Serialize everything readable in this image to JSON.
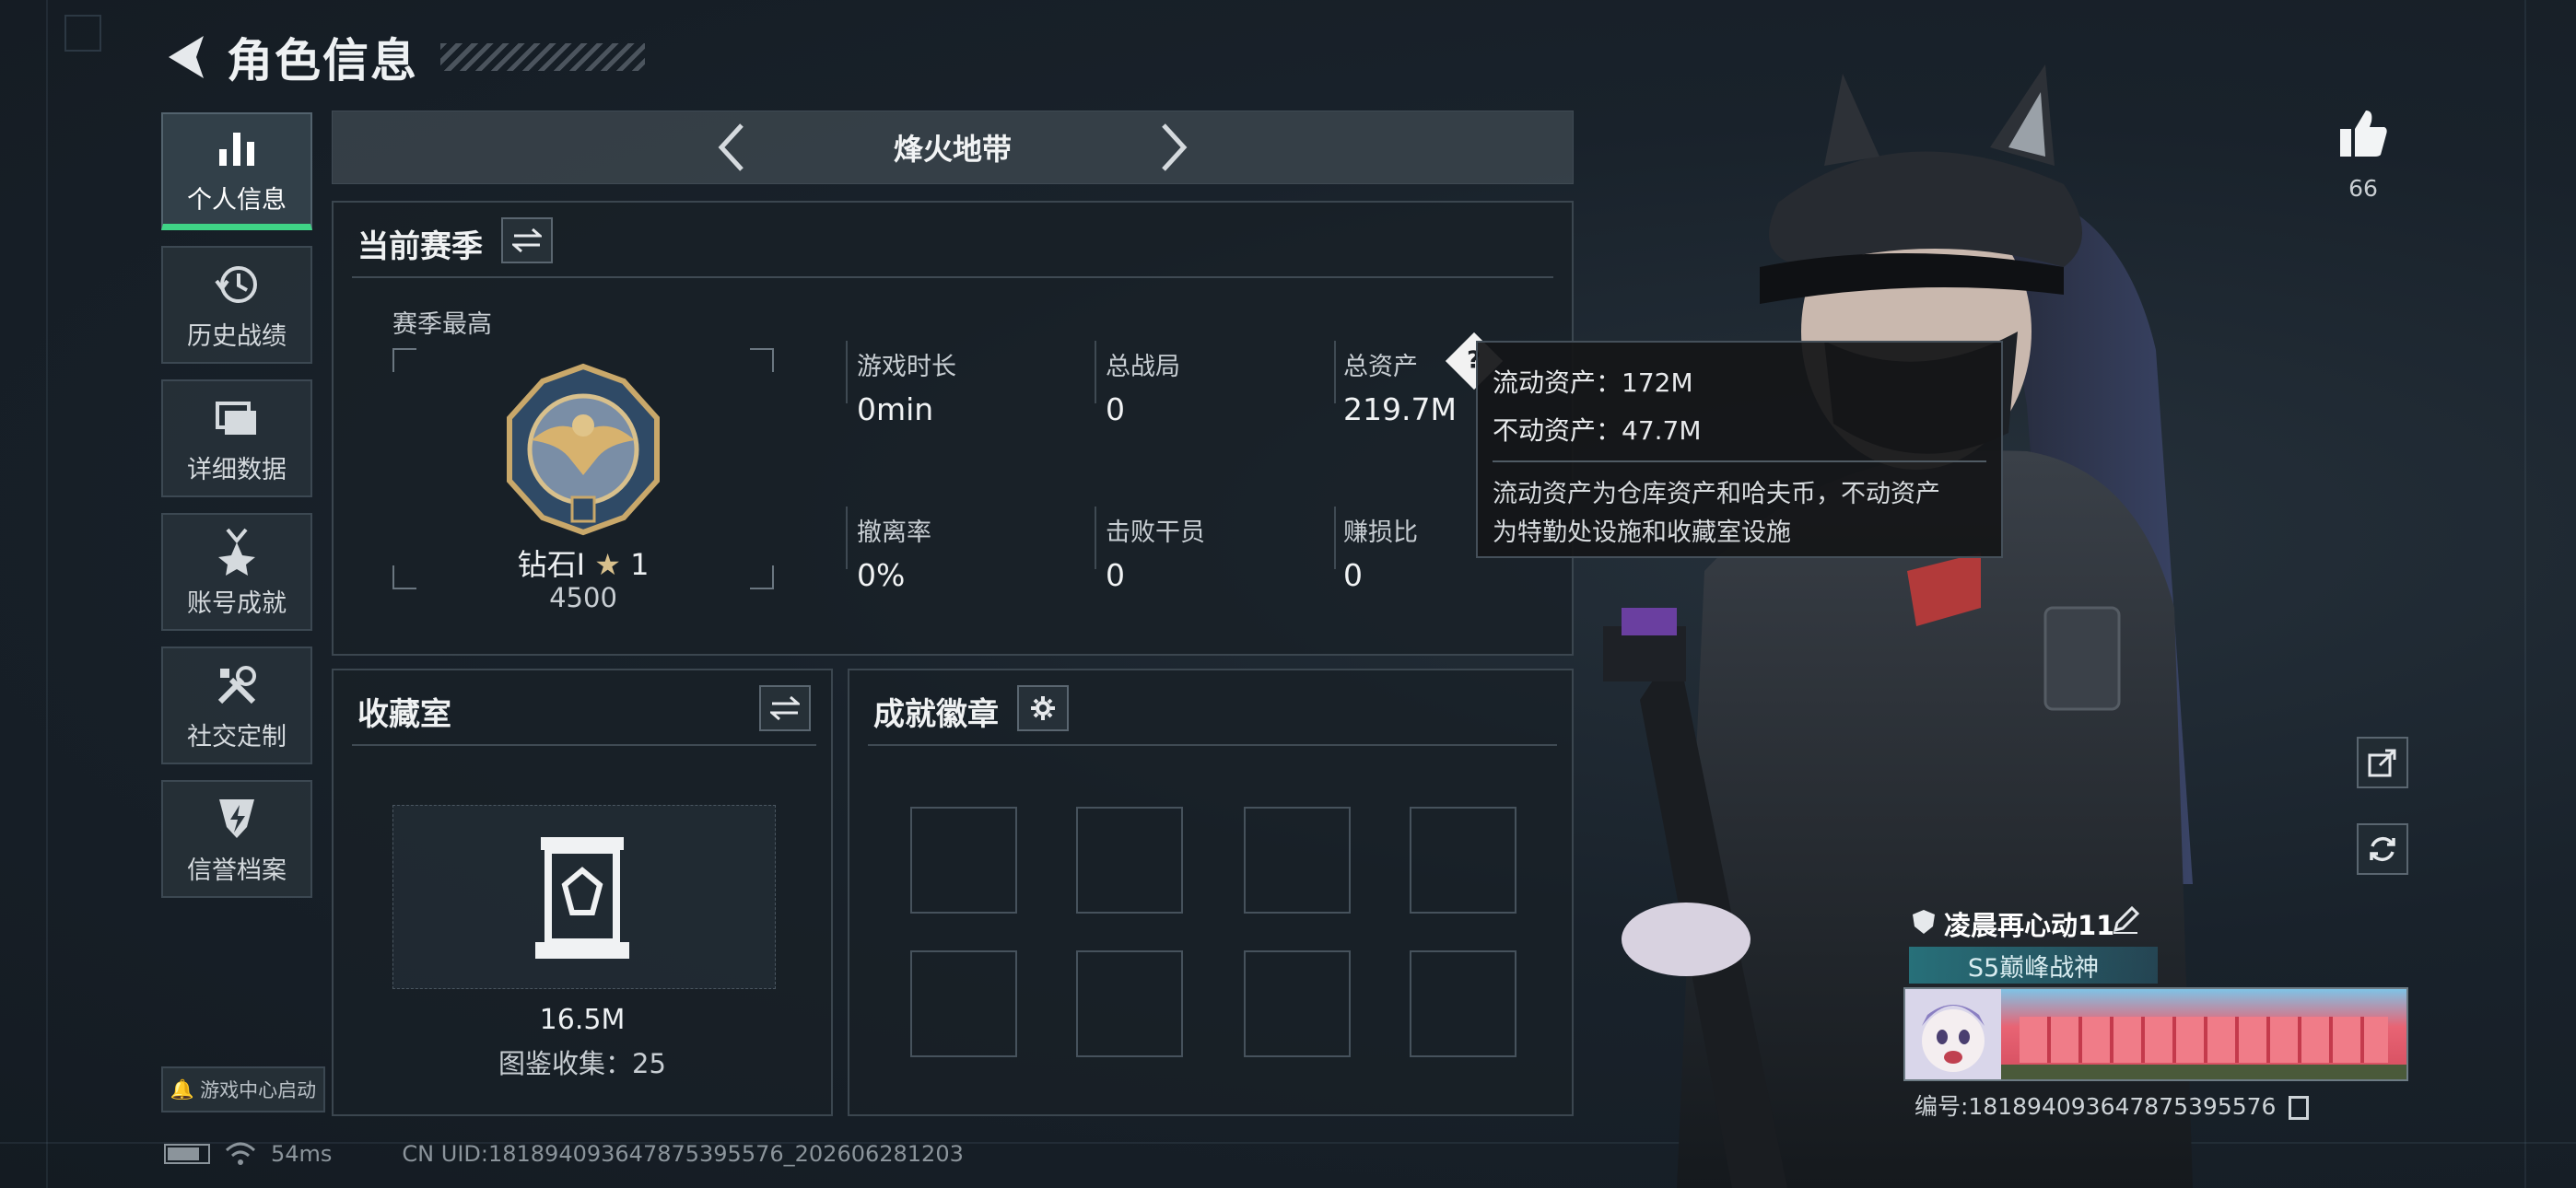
{
  "header": {
    "title": "角色信息"
  },
  "nav": [
    {
      "label": "个人信息",
      "icon": "bar-chart-icon",
      "active": true
    },
    {
      "label": "历史战绩",
      "icon": "history-clock-icon",
      "active": false
    },
    {
      "label": "详细数据",
      "icon": "folder-icon",
      "active": false
    },
    {
      "label": "账号成就",
      "icon": "medal-icon",
      "active": false
    },
    {
      "label": "社交定制",
      "icon": "tools-icon",
      "active": false
    },
    {
      "label": "信誉档案",
      "icon": "shield-bolt-icon",
      "active": false
    }
  ],
  "launch": {
    "label": "游戏中心启动"
  },
  "mode": {
    "name": "烽火地带"
  },
  "season": {
    "title": "当前赛季",
    "best_label": "赛季最高",
    "rank_name": "钻石I",
    "rank_stars": "1",
    "rank_score": "4500",
    "stats": [
      {
        "label": "游戏时长",
        "value": "0min"
      },
      {
        "label": "总战局",
        "value": "0"
      },
      {
        "label": "总资产",
        "value": "219.7M"
      },
      {
        "label": "撤离率",
        "value": "0%"
      },
      {
        "label": "击败干员",
        "value": "0"
      },
      {
        "label": "赚损比",
        "value": "0"
      }
    ]
  },
  "tooltip": {
    "line1": "流动资产：172M",
    "line2": "不动资产：47.7M",
    "desc1": "流动资产为仓库资产和哈夫币，不动资产",
    "desc2": "为特勤处设施和收藏室设施"
  },
  "collection": {
    "title": "收藏室",
    "value": "16.5M",
    "count_label": "图鉴收集：25"
  },
  "badges": {
    "title": "成就徽章",
    "slots": 8
  },
  "likes": {
    "count": "66"
  },
  "player": {
    "name": "凌晨再心动11",
    "title": "S5巅峰战神",
    "id_text": "编号:18189409364787539557​6"
  },
  "status": {
    "ping": "54ms",
    "uid": "CN UID:18189409364787539557​6_202606281203"
  },
  "colors": {
    "accent": "#3fd486",
    "panel_border": "#3b464f",
    "background": "#19222b"
  }
}
